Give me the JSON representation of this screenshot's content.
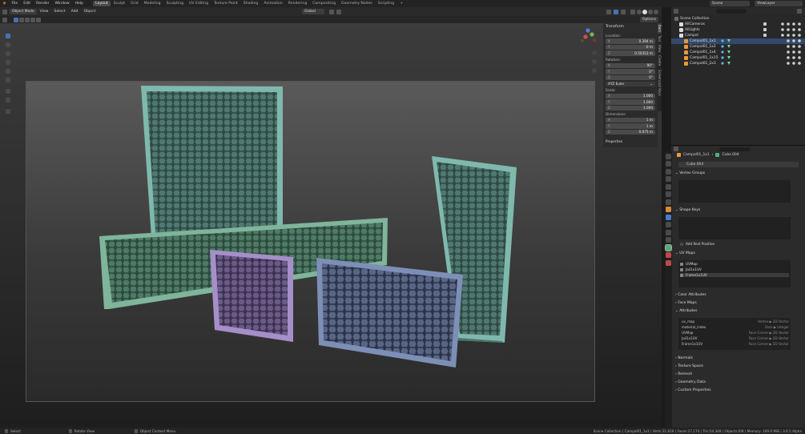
{
  "menu": [
    "File",
    "Edit",
    "Render",
    "Window",
    "Help"
  ],
  "workspaces": [
    "Layout",
    "Sculpt",
    "Grid",
    "Modeling",
    "Sculpting",
    "UV Editing",
    "Texture Paint",
    "Shading",
    "Animation",
    "Rendering",
    "Compositing",
    "Geometry Nodes",
    "Scripting"
  ],
  "workspace_add": "+",
  "active_workspace": "Layout",
  "scene": {
    "label": "Scene",
    "view_layer": "ViewLayer"
  },
  "viewport_header": {
    "mode": "Object Mode",
    "menus": [
      "View",
      "Select",
      "Add",
      "Object"
    ],
    "orientation": "Global",
    "options": "Options"
  },
  "npanel": {
    "title": "Transform",
    "location_label": "Location:",
    "location": [
      [
        "X",
        "0.394 m"
      ],
      [
        "Y",
        "-0 m"
      ],
      [
        "Z",
        "0.50353 m"
      ]
    ],
    "rotation_label": "Rotation:",
    "rotation": [
      [
        "X",
        "90°"
      ],
      [
        "Y",
        "0°"
      ],
      [
        "Z",
        "0°"
      ]
    ],
    "rotation_mode": "XYZ Euler",
    "scale_label": "Scale:",
    "scale": [
      [
        "X",
        "1.000"
      ],
      [
        "Y",
        "1.000"
      ],
      [
        "Z",
        "1.000"
      ]
    ],
    "dimensions_label": "Dimensions:",
    "dimensions": [
      [
        "X",
        "1 m"
      ],
      [
        "Y",
        "1 m"
      ],
      [
        "Z",
        "0.075 m"
      ]
    ],
    "properties": "Properties"
  },
  "side_tabs": [
    "Item",
    "Tool",
    "View",
    "Create",
    "Screencast Keys"
  ],
  "outliner": {
    "rows": [
      "Scene Collection",
      "AllCameras",
      "AllLights",
      "Campol",
      "Campol01_1x1",
      "Campol01_1x2",
      "Campol01_1x4",
      "Campol01_1x15",
      "Campol01_2x3"
    ]
  },
  "props": {
    "breadcrumb_obj": "Campol01_1x1",
    "breadcrumb_mesh": "Cube.004",
    "mesh_name": "Cube.004",
    "sections": {
      "vertex_groups": "Vertex Groups",
      "shape_keys": "Shape Keys",
      "add_rest": "Add Rest Position",
      "uv_maps": "UV Maps",
      "color_attributes": "Color Attributes",
      "face_maps": "Face Maps",
      "attributes": "Attributes",
      "normals": "Normals",
      "texture_space": "Texture Space",
      "remesh": "Remesh",
      "geometry_data": "Geometry Data",
      "custom_properties": "Custom Properties"
    },
    "uv_list": [
      "UVMap",
      "Jail1x1UV",
      "Frame1x1UV"
    ],
    "attributes": [
      [
        "uv_map",
        "Vertex ▶ 2D Vector"
      ],
      [
        "material_index",
        "Face ▶ Integer"
      ],
      [
        "UVMap",
        "Face Corner ▶ 2D Vector"
      ],
      [
        "Jail1x1UV",
        "Face Corner ▶ 2D Vector"
      ],
      [
        "Frame1x1UV",
        "Face Corner ▶ 2D Vector"
      ]
    ]
  },
  "status": {
    "select": "Select",
    "rotate": "Rotate View",
    "context": "Object Context Menu",
    "info": "Scene Collection | Campol01_1x1 | Verts:31,616 | Faces:27,174 | Tris:54,348 | Objects:0/8 | Memory: 109.0 MiB | 3.6.5 Alpha"
  },
  "colors": {
    "teal": "#7fb9ad",
    "green": "#7fb59a",
    "purple": "#a68fc9",
    "blue": "#7d8fb7",
    "accent": "#4772b3"
  }
}
